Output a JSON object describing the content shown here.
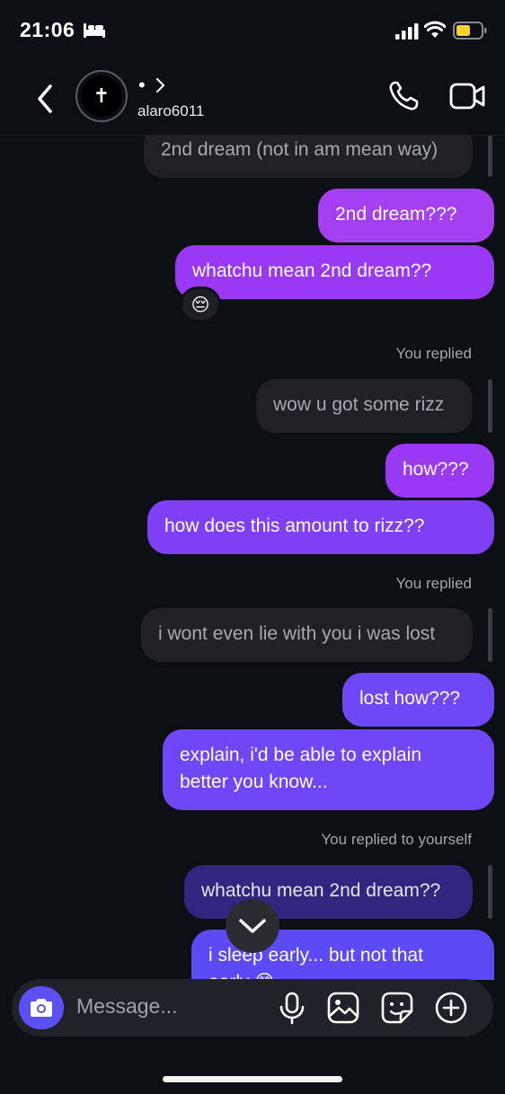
{
  "status_bar": {
    "time": "21:06"
  },
  "header": {
    "display_name_dot": "•",
    "username": "alaro6011",
    "avatar_glyph": "✝"
  },
  "messages": [
    {
      "id": "m1",
      "kind": "received",
      "text": "2nd dream (not in am mean way)"
    },
    {
      "id": "m2",
      "kind": "sent",
      "text": "2nd dream???"
    },
    {
      "id": "m3",
      "kind": "sent",
      "text": "whatchu mean 2nd dream??",
      "reaction": "😔"
    },
    {
      "id": "l1",
      "kind": "label",
      "text": "You replied"
    },
    {
      "id": "m4",
      "kind": "received",
      "text": "wow u got some rizz"
    },
    {
      "id": "m5",
      "kind": "sent",
      "text": "how???"
    },
    {
      "id": "m6",
      "kind": "sent",
      "text": "how does this amount to rizz??"
    },
    {
      "id": "l2",
      "kind": "label",
      "text": "You replied"
    },
    {
      "id": "m7",
      "kind": "received",
      "text": "i wont even lie with you i was lost"
    },
    {
      "id": "m8",
      "kind": "sent",
      "text": "lost how???"
    },
    {
      "id": "m9",
      "kind": "sent",
      "line1": "explain, i'd be able to explain",
      "line2": "better you know..."
    },
    {
      "id": "l3",
      "kind": "label",
      "text": "You replied to yourself"
    },
    {
      "id": "m10",
      "kind": "sent_quoted",
      "text": "whatchu mean 2nd dream??"
    },
    {
      "id": "m11",
      "kind": "sent",
      "line1": "i sleep early... but not that",
      "line2": "early 😅"
    }
  ],
  "composer": {
    "placeholder": "Message..."
  },
  "icons": [
    "back-icon",
    "chevron-right-icon",
    "phone-icon",
    "video-icon",
    "camera-icon",
    "mic-icon",
    "image-icon",
    "sticker-icon",
    "plus-icon",
    "chevron-down-icon"
  ],
  "colors": {
    "background": "#0c0f14",
    "received_bubble": "#1f2126",
    "sent_top": "#a43ff2",
    "sent_bottom": "#5c4af5",
    "camera_button": "#5b50f6"
  }
}
